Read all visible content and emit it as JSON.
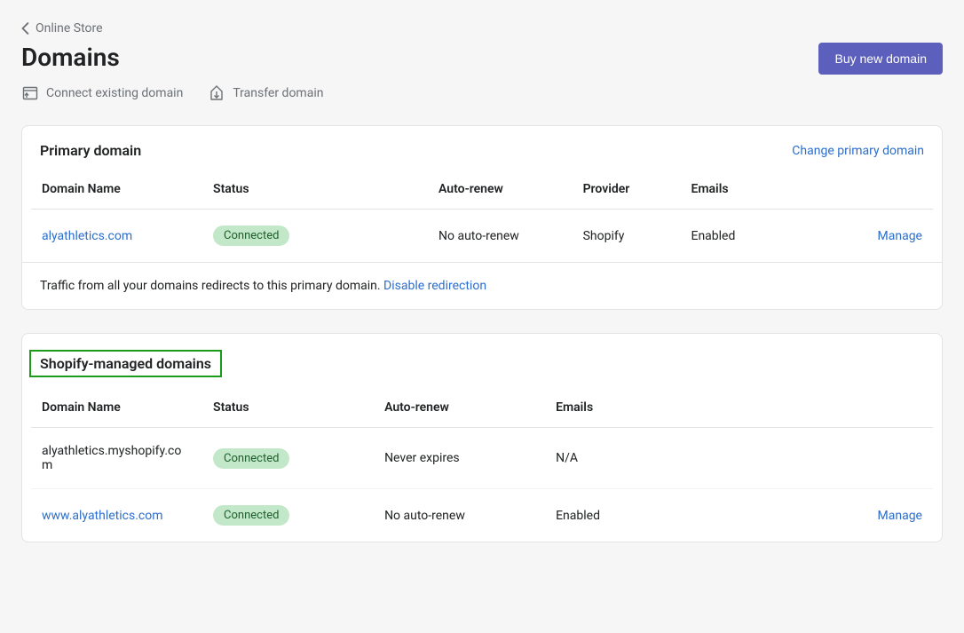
{
  "breadcrumb": {
    "label": "Online Store"
  },
  "page": {
    "title": "Domains"
  },
  "buttons": {
    "buy_new_domain": "Buy new domain",
    "connect_existing": "Connect existing domain",
    "transfer_domain": "Transfer domain"
  },
  "primary_section": {
    "title": "Primary domain",
    "change_link": "Change primary domain",
    "columns": {
      "name": "Domain Name",
      "status": "Status",
      "autorenew": "Auto-renew",
      "provider": "Provider",
      "emails": "Emails"
    },
    "rows": [
      {
        "name": "alyathletics.com",
        "status": "Connected",
        "autorenew": "No auto-renew",
        "provider": "Shopify",
        "emails": "Enabled",
        "manage": "Manage"
      }
    ],
    "footer_text": "Traffic from all your domains redirects to this primary domain. ",
    "footer_link": "Disable redirection"
  },
  "managed_section": {
    "title": "Shopify-managed domains",
    "columns": {
      "name": "Domain Name",
      "status": "Status",
      "autorenew": "Auto-renew",
      "emails": "Emails"
    },
    "rows": [
      {
        "name": "alyathletics.myshopify.com",
        "status": "Connected",
        "autorenew": "Never expires",
        "emails": "N/A",
        "manage": ""
      },
      {
        "name": "www.alyathletics.com",
        "status": "Connected",
        "autorenew": "No auto-renew",
        "emails": "Enabled",
        "manage": "Manage"
      }
    ]
  }
}
